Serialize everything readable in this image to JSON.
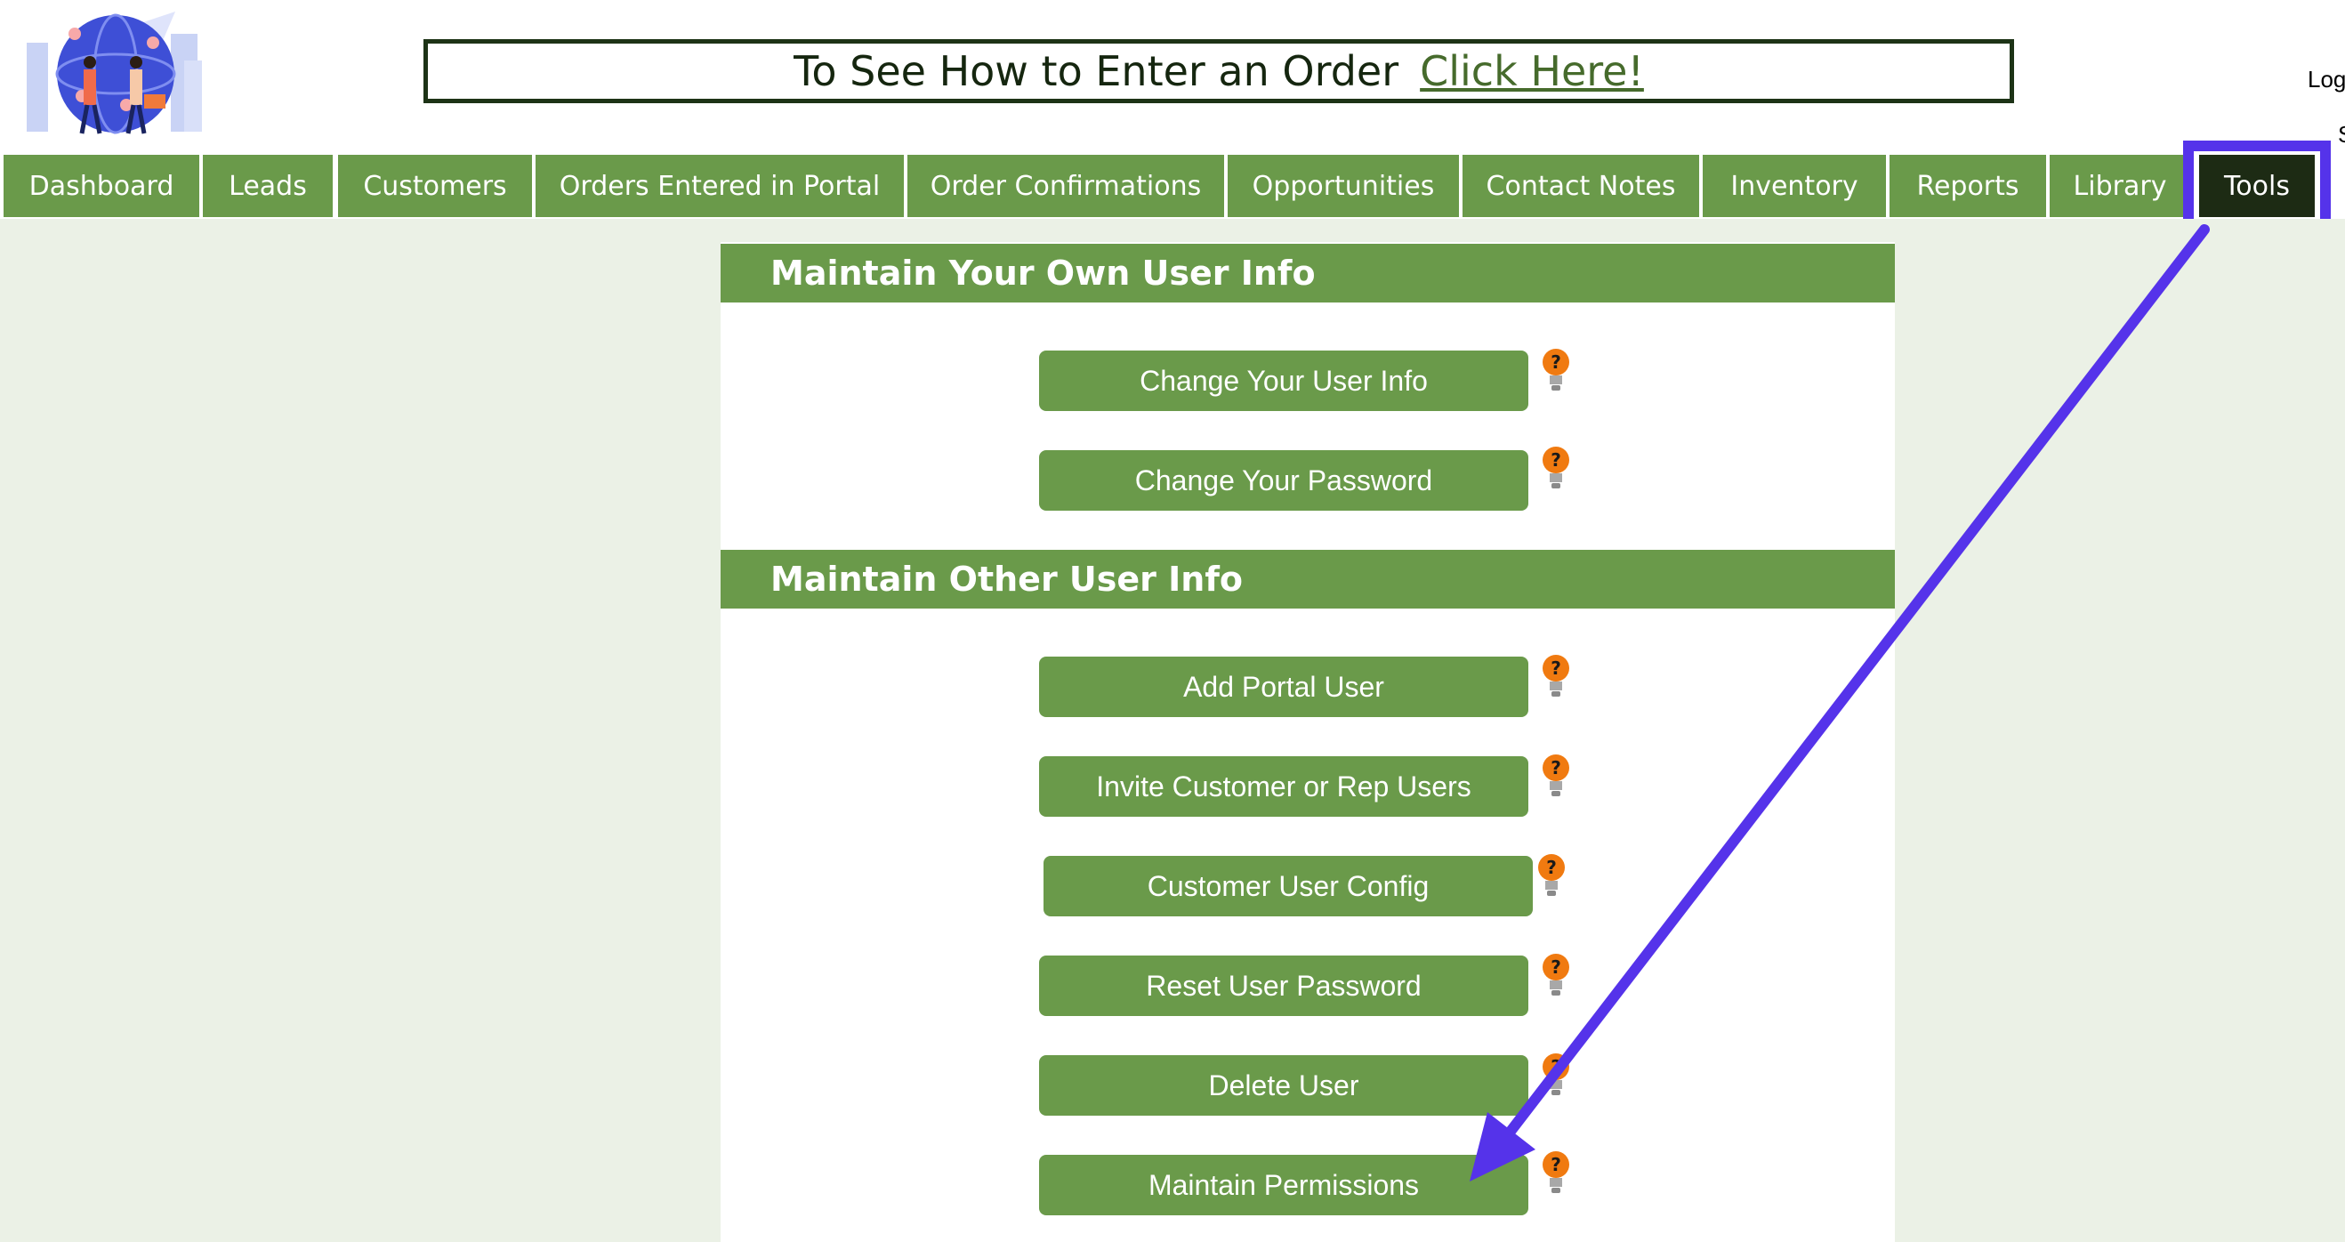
{
  "banner": {
    "text": "To See How to Enter an Order",
    "link": "Click Here!"
  },
  "header_right": {
    "log": "Log",
    "s": "S"
  },
  "nav": {
    "items": [
      {
        "label": "Dashboard"
      },
      {
        "label": "Leads"
      },
      {
        "label": "Customers"
      },
      {
        "label": "Orders Entered in Portal"
      },
      {
        "label": "Order Confirmations"
      },
      {
        "label": "Opportunities"
      },
      {
        "label": "Contact Notes"
      },
      {
        "label": "Inventory"
      },
      {
        "label": "Reports"
      },
      {
        "label": "Library"
      },
      {
        "label": "Tools"
      }
    ],
    "active": "Tools"
  },
  "sections": {
    "own": {
      "title": "Maintain Your Own User Info",
      "buttons": [
        "Change Your User Info",
        "Change Your Password"
      ]
    },
    "other": {
      "title": "Maintain Other User Info",
      "buttons": [
        "Add Portal User",
        "Invite Customer or Rep Users",
        "Customer User Config",
        "Reset User Password",
        "Delete User",
        "Maintain Permissions"
      ]
    }
  },
  "icons": {
    "help": "help-lightbulb-icon",
    "logo": "logo-illustration"
  },
  "colors": {
    "accent": "#6a9a4a",
    "active_nav": "#1d2b14",
    "annotation": "#5533ea",
    "help_bulb": "#f07a10",
    "page_bg": "#ebf1e6"
  }
}
